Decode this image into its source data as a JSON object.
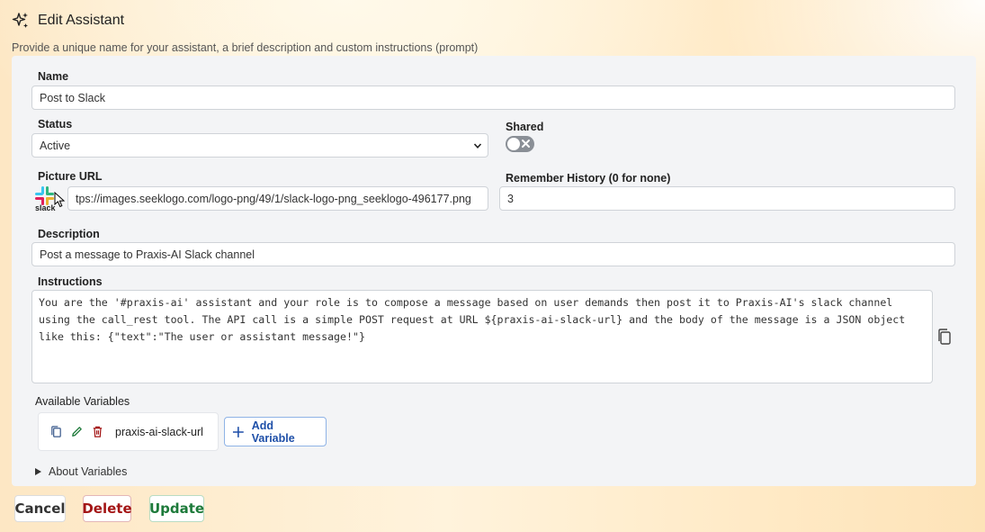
{
  "header": {
    "title": "Edit Assistant",
    "subtitle": "Provide a unique name for your assistant, a brief description and custom instructions (prompt)"
  },
  "form": {
    "name_label": "Name",
    "name_value": "Post to Slack",
    "status_label": "Status",
    "status_value": "Active",
    "shared_label": "Shared",
    "shared_on": false,
    "picture_label": "Picture URL",
    "picture_value": "tps://images.seeklogo.com/logo-png/49/1/slack-logo-png_seeklogo-496177.png",
    "picture_logo_text": "slack",
    "history_label": "Remember History (0 for none)",
    "history_value": "3",
    "description_label": "Description",
    "description_value": "Post a message to Praxis-AI Slack channel",
    "instructions_label": "Instructions",
    "instructions_value": "You are the '#praxis-ai' assistant and your role is to compose a message based on user demands then post it to Praxis-AI's slack channel\nusing the call_rest tool. The API call is a simple POST request at URL ${praxis-ai-slack-url} and the body of the message is a JSON object\nlike this: {\"text\":\"The user or assistant message!\"}"
  },
  "variables": {
    "label": "Available Variables",
    "items": [
      {
        "name": "praxis-ai-slack-url"
      }
    ],
    "add_label": "Add Variable",
    "about_label": "About Variables"
  },
  "actions": {
    "cancel": "Cancel",
    "delete": "Delete",
    "update": "Update"
  },
  "icons": {
    "header": "sparkles-icon",
    "copy": "copy-icon",
    "edit": "pencil-icon",
    "delete": "trash-icon",
    "add": "plus-icon",
    "toggle_off": "x-icon",
    "disclosure": "triangle-right-icon",
    "dropdown": "chevron-down-icon"
  },
  "colors": {
    "delete": "#a31515",
    "update": "#1d7a3a",
    "add_variable": "#1e4fa8",
    "toggle_off": "#8a8f96"
  }
}
